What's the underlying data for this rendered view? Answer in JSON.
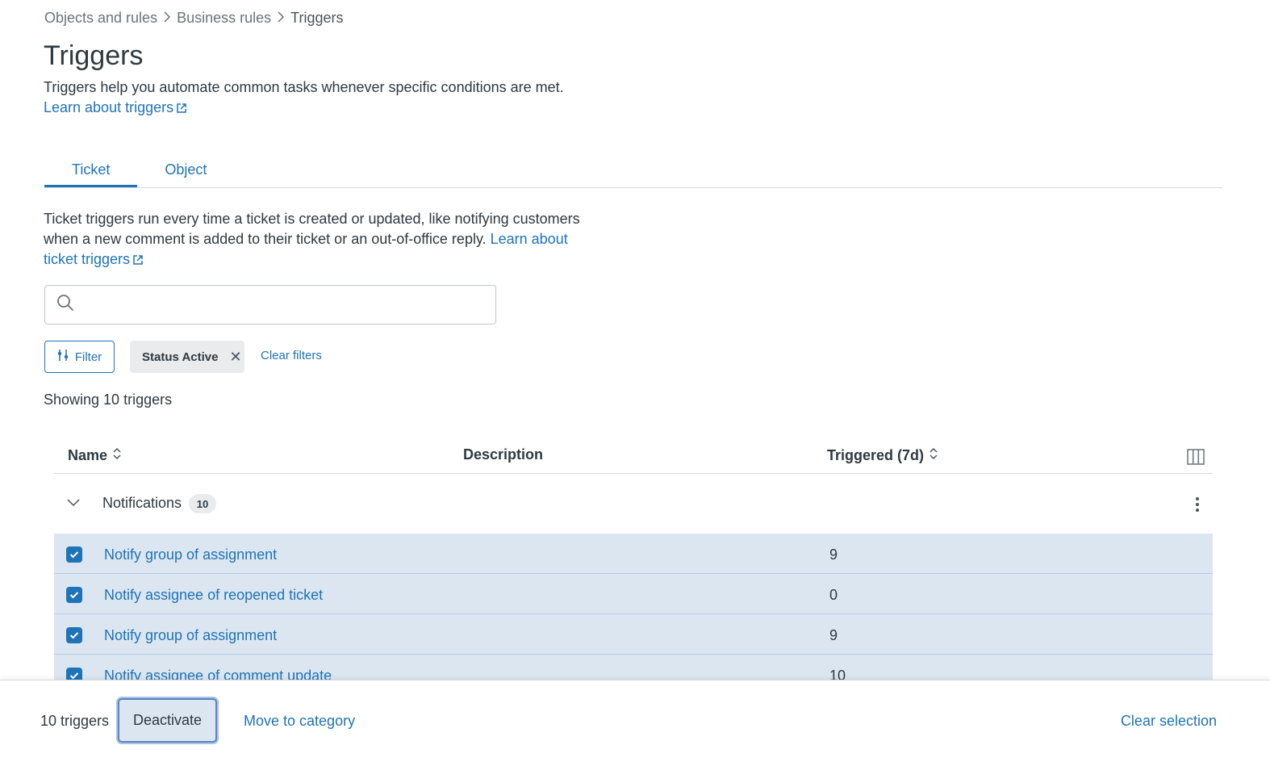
{
  "breadcrumb": {
    "items": [
      "Objects and rules",
      "Business rules",
      "Triggers"
    ]
  },
  "page": {
    "title": "Triggers",
    "description": "Triggers help you automate common tasks whenever specific conditions are met. ",
    "learn_link": "Learn about triggers"
  },
  "tabs": [
    {
      "label": "Ticket",
      "active": true
    },
    {
      "label": "Object",
      "active": false
    }
  ],
  "ticket_section": {
    "description": "Ticket triggers run every time a ticket is created or updated, like notifying customers when a new comment is added to their ticket or an out-of-office reply. ",
    "learn_link": "Learn about ticket triggers"
  },
  "search": {
    "value": "",
    "placeholder": ""
  },
  "filters": {
    "filter_label": "Filter",
    "active_chip": "Status Active",
    "clear_label": "Clear filters"
  },
  "showing_text": "Showing 10 triggers",
  "table": {
    "headers": {
      "name": "Name",
      "description": "Description",
      "triggered": "Triggered (7d)"
    },
    "group": {
      "name": "Notifications",
      "count": "10"
    },
    "rows": [
      {
        "name": "Notify group of assignment",
        "triggered": "9",
        "checked": true
      },
      {
        "name": "Notify assignee of reopened ticket",
        "triggered": "0",
        "checked": true
      },
      {
        "name": "Notify group of assignment",
        "triggered": "9",
        "checked": true
      },
      {
        "name": "Notify assignee of comment update",
        "triggered": "10",
        "checked": true
      }
    ]
  },
  "bottom_bar": {
    "selected_count": "10 triggers",
    "deactivate": "Deactivate",
    "move_to_category": "Move to category",
    "clear_selection": "Clear selection"
  },
  "colors": {
    "link": "#1f73b7",
    "text": "#2f3941",
    "selected_row": "#dbe6f1"
  }
}
